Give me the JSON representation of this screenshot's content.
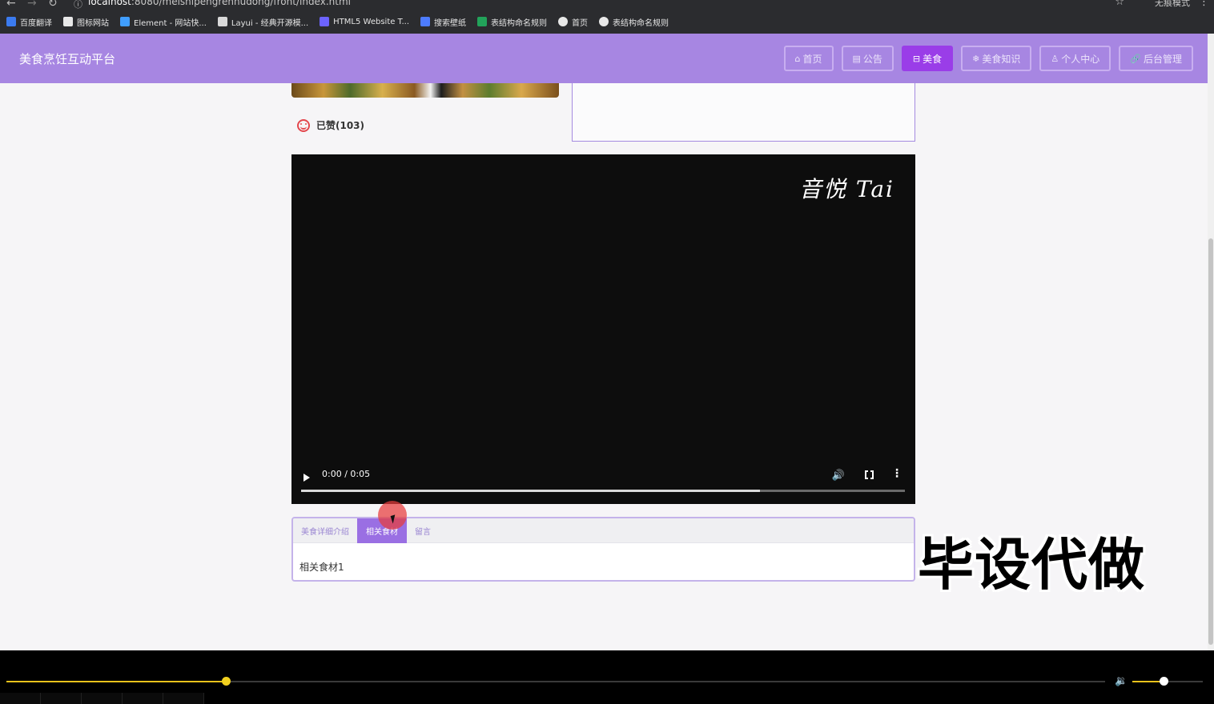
{
  "browser": {
    "url_host": "localhost",
    "url_path": ":8080/meishipengrenhudong/front/index.html",
    "profile_label": "无痕模式",
    "bookmarks": [
      {
        "label": "百度翻译",
        "icon": "translate-icon",
        "color": "#3b7bf0"
      },
      {
        "label": "图标网站",
        "icon": "flag-icon",
        "color": "#e8e8e8"
      },
      {
        "label": "Element - 网站快...",
        "icon": "element-icon",
        "color": "#409eff"
      },
      {
        "label": "Layui - 经典开源模...",
        "icon": "layui-icon",
        "color": "#d9d9d9"
      },
      {
        "label": "HTML5 Website T...",
        "icon": "html5-icon",
        "color": "#6c63ff"
      },
      {
        "label": "搜索壁纸",
        "icon": "wallpaper-icon",
        "color": "#4d7cff"
      },
      {
        "label": "表结构命名规则",
        "icon": "sheet-icon",
        "color": "#22a35a"
      },
      {
        "label": "首页",
        "icon": "globe-icon",
        "color": "#e8e8e8"
      },
      {
        "label": "表结构命名规则",
        "icon": "globe-icon",
        "color": "#e8e8e8"
      }
    ]
  },
  "header": {
    "title": "美食烹饪互动平台",
    "nav": [
      {
        "label": "首页",
        "icon": "home-icon",
        "glyph": "⌂",
        "active": false
      },
      {
        "label": "公告",
        "icon": "notice-icon",
        "glyph": "▤",
        "active": false
      },
      {
        "label": "美食",
        "icon": "food-icon",
        "glyph": "⊟",
        "active": true
      },
      {
        "label": "美食知识",
        "icon": "knowledge-icon",
        "glyph": "❄",
        "active": false
      },
      {
        "label": "个人中心",
        "icon": "user-icon",
        "glyph": "♙",
        "active": false
      },
      {
        "label": "后台管理",
        "icon": "link-icon",
        "glyph": "🔗",
        "active": false
      }
    ]
  },
  "content": {
    "like_label": "已赞(103)",
    "video": {
      "watermark": "音悦 Tai",
      "time": "0:00 / 0:05",
      "buffered_fraction": 0.76
    },
    "tabs": [
      {
        "label": "美食详细介绍",
        "active": false
      },
      {
        "label": "相关食材",
        "active": true
      },
      {
        "label": "留言",
        "active": false
      }
    ],
    "tab_content": "相关食材1"
  },
  "overlay_text": "毕设代做",
  "player": {
    "seek_fraction": 0.2,
    "volume_fraction": 0.44
  },
  "colors": {
    "header_bg": "#a786e2",
    "nav_active": "#9a3de8",
    "tab_active": "#9a6fe3",
    "accent_yellow": "#e8c21b"
  }
}
